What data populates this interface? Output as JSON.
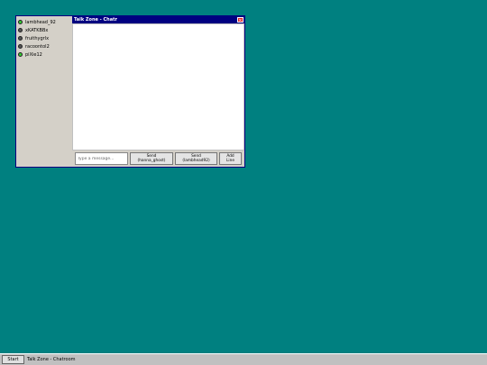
{
  "sidebar": {
    "users": [
      {
        "name": "lambhead_92",
        "status": "online"
      },
      {
        "name": "xKATKBBx",
        "status": "offline"
      },
      {
        "name": "fruithygrlx",
        "status": "offline"
      },
      {
        "name": "racoontol2",
        "status": "offline"
      },
      {
        "name": "piXie12",
        "status": "online"
      }
    ]
  },
  "window": {
    "title": "Talk Zone - Chatr",
    "close_icon": "close-icon"
  },
  "composer": {
    "placeholder": "Type a message...",
    "send_hanna_line1": "Send",
    "send_hanna_line2": "(hanna_ghost)",
    "send_lamb_line1": "Send",
    "send_lamb_line2": "(lambhead92)",
    "addline_line1": "Add",
    "addline_line2": "Line"
  },
  "taskbar": {
    "start_label": "Start",
    "task_label": "Talk Zone - Chatroom"
  },
  "colors": {
    "desktop": "#008080",
    "titlebar": "#000080",
    "online": "#33cc33",
    "offline": "#555555"
  }
}
